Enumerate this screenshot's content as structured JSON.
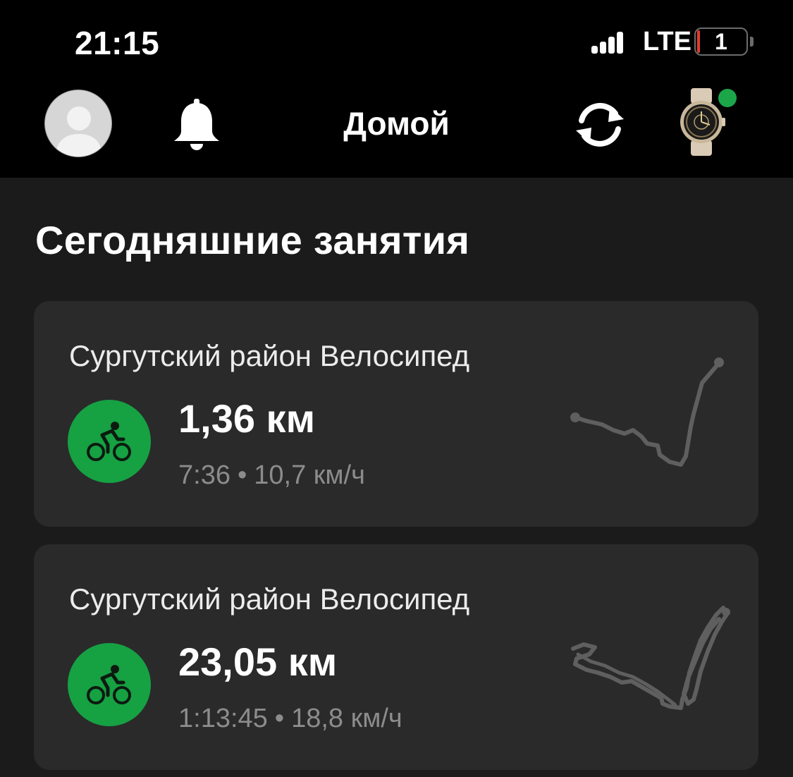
{
  "status_bar": {
    "time": "21:15",
    "network": "LTE",
    "battery_level": "1",
    "battery_color": "#e23b30"
  },
  "header": {
    "title": "Домой",
    "icons": [
      "avatar",
      "bell-icon",
      "sync-icon",
      "watch-device-icon"
    ],
    "device_connected_color": "#1ba64a"
  },
  "section": {
    "title": "Сегодняшние занятия"
  },
  "activities": [
    {
      "title": "Сургутский район Велосипед",
      "distance": "1,36 км",
      "duration": "7:36",
      "separator": "•",
      "speed": "10,7 км/ч",
      "icon": "bicycle-icon"
    },
    {
      "title": "Сургутский район Велосипед",
      "distance": "23,05 км",
      "duration": "1:13:45",
      "separator": "•",
      "speed": "18,8 км/ч",
      "icon": "bicycle-icon"
    }
  ],
  "colors": {
    "accent_green": "#16a143",
    "card_bg": "#2a2a2a",
    "page_bg": "#1b1b1b"
  }
}
